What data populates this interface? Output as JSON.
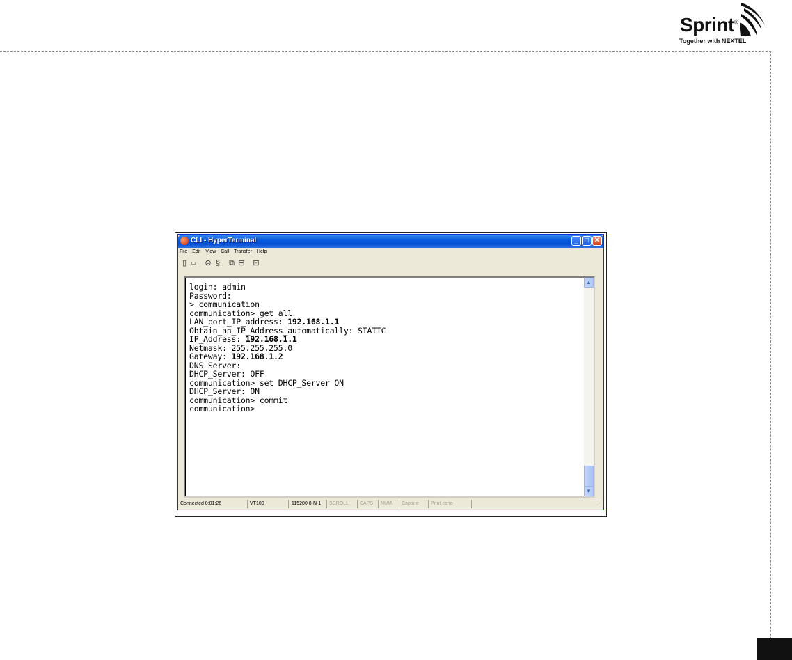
{
  "logo": {
    "brand": "Sprint",
    "registered": "®",
    "tagline": "Together with NEXTEL"
  },
  "window": {
    "title": "CLI - HyperTerminal",
    "menu": [
      "File",
      "Edit",
      "View",
      "Call",
      "Transfer",
      "Help"
    ],
    "toolbar_icons": [
      "new-file-icon",
      "open-folder-icon",
      "properties-icon",
      "disconnect-icon",
      "send-icon",
      "receive-icon",
      "settings-icon"
    ]
  },
  "terminal": {
    "lines": [
      {
        "text": "login: admin",
        "bold": ""
      },
      {
        "text": "Password:",
        "bold": ""
      },
      {
        "text": "> communication",
        "bold": ""
      },
      {
        "text": "communication> get all",
        "bold": ""
      },
      {
        "text": "LAN_port_IP_address: ",
        "bold": "192.168.1.1"
      },
      {
        "text": "Obtain_an_IP_Address_automatically: STATIC",
        "bold": ""
      },
      {
        "text": "IP_Address: ",
        "bold": "192.168.1.1"
      },
      {
        "text": "Netmask: 255.255.255.0",
        "bold": ""
      },
      {
        "text": "Gateway: ",
        "bold": "192.168.1.2"
      },
      {
        "text": "DNS_Server:",
        "bold": ""
      },
      {
        "text": "DHCP_Server: OFF",
        "bold": ""
      },
      {
        "text": "communication> set DHCP_Server ON",
        "bold": ""
      },
      {
        "text": "DHCP_Server: ON",
        "bold": ""
      },
      {
        "text": "communication> commit",
        "bold": ""
      },
      {
        "text": "communication>",
        "bold": ""
      }
    ]
  },
  "status": {
    "connected": "Connected 0:01:26",
    "emulation": "VT100",
    "settings": "115200 8-N-1",
    "scroll": "SCROLL",
    "caps": "CAPS",
    "num": "NUM",
    "capture": "Capture",
    "print_echo": "Print echo"
  }
}
